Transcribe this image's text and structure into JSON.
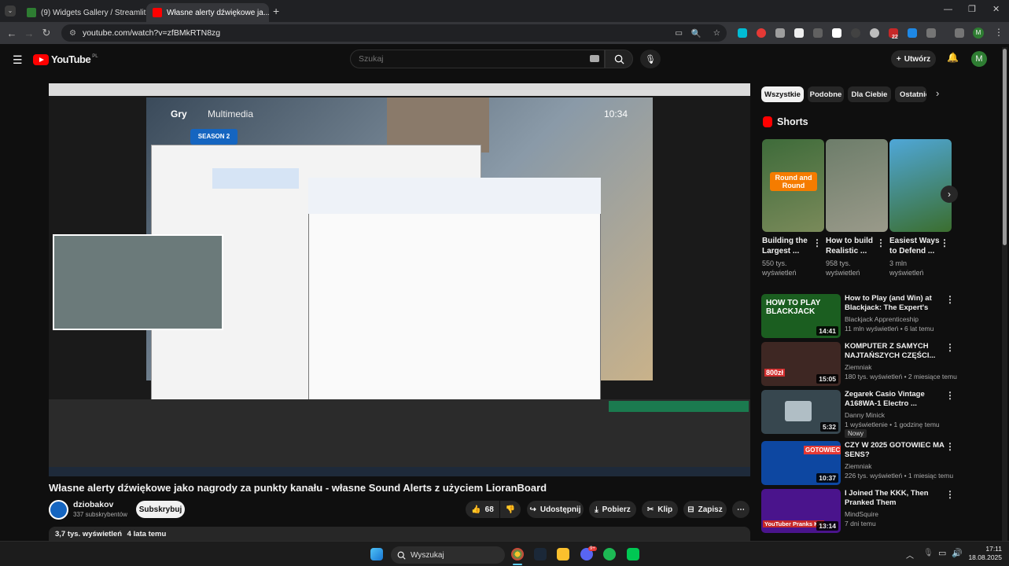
{
  "browser": {
    "tabs": [
      {
        "title": "(9) Widgets Gallery / Streamlit"
      },
      {
        "title": "Własne alerty dźwiękowe ja..."
      }
    ],
    "url": "youtube.com/watch?v=zfBMkRTN8zg",
    "extension_badge": "22",
    "profile_initial": "M"
  },
  "youtube": {
    "logo_text": "YouTube",
    "region": "PL",
    "search_placeholder": "Szukaj",
    "create_label": "Utwórz",
    "avatar_initial": "M"
  },
  "video": {
    "title": "Własne alerty dźwiękowe jako nagrody za punkty kanału - własne Sound Alerts z użyciem LioranBoard",
    "overlay_tabs": [
      "Gry",
      "Multimedia"
    ],
    "overlay_time": "10:34",
    "overlay_badge": "SEASON 2",
    "channel": "dziobakov",
    "subscribers": "337 subskrybentów",
    "subscribe_label": "Subskrybuj",
    "likes": "68",
    "share_label": "Udostępnij",
    "download_label": "Pobierz",
    "clip_label": "Klip",
    "save_label": "Zapisz",
    "views": "3,7 tys. wyświetleń",
    "age": "4 lata temu"
  },
  "filters": [
    "Wszystkie",
    "Podobne",
    "Dla Ciebie",
    "Ostatnio"
  ],
  "shorts_header": "Shorts",
  "shorts": [
    {
      "title": "Building the Largest ...",
      "views": "550 tys. wyświetleń",
      "thumb_text": "Round and Round"
    },
    {
      "title": "How to build Realistic ...",
      "views": "958 tys. wyświetleń",
      "thumb_text": ""
    },
    {
      "title": "Easiest Ways to Defend ...",
      "views": "3 mln wyświetleń",
      "thumb_text": ""
    }
  ],
  "recommendations": [
    {
      "title": "How to Play (and Win) at Blackjack: The Expert's Guide",
      "channel": "Blackjack Apprenticeship",
      "meta": "11 mln wyświetleń • 6 lat temu",
      "duration": "14:41",
      "thumb_text": "HOW TO PLAY BLACKJACK",
      "thumb_color": "#1b5e20",
      "badge": ""
    },
    {
      "title": "KOMPUTER Z SAMYCH NAJTAŃSZYCH CZĘŚCI...",
      "channel": "Ziemniak",
      "meta": "180 tys. wyświetleń • 2 miesiące temu",
      "duration": "15:05",
      "thumb_text": "800zł",
      "thumb_color": "#3e2723",
      "badge": ""
    },
    {
      "title": "Zegarek Casio Vintage A168WA-1 Electro ...",
      "channel": "Danny Minick",
      "meta": "1 wyświetlenie • 1 godzinę temu",
      "duration": "5:32",
      "thumb_text": "",
      "thumb_color": "#37474f",
      "badge": "Nowy"
    },
    {
      "title": "CZY W 2025 GOTOWIEC MA SENS?",
      "channel": "Ziemniak",
      "meta": "226 tys. wyświetleń • 1 miesiąc temu",
      "duration": "10:37",
      "thumb_text": "GOTOWIEC",
      "thumb_color": "#0d47a1",
      "badge": ""
    },
    {
      "title": "I Joined The KKK, Then Pranked Them",
      "channel": "MindSquire",
      "meta": "7 dni temu",
      "duration": "13:14",
      "thumb_text": "YouTuber Pranks KK",
      "thumb_color": "#4a148c",
      "badge": ""
    }
  ],
  "taskbar": {
    "search_label": "Wyszukaj",
    "time": "17:11",
    "date": "18.08.2025",
    "discord_badge": "9+"
  }
}
